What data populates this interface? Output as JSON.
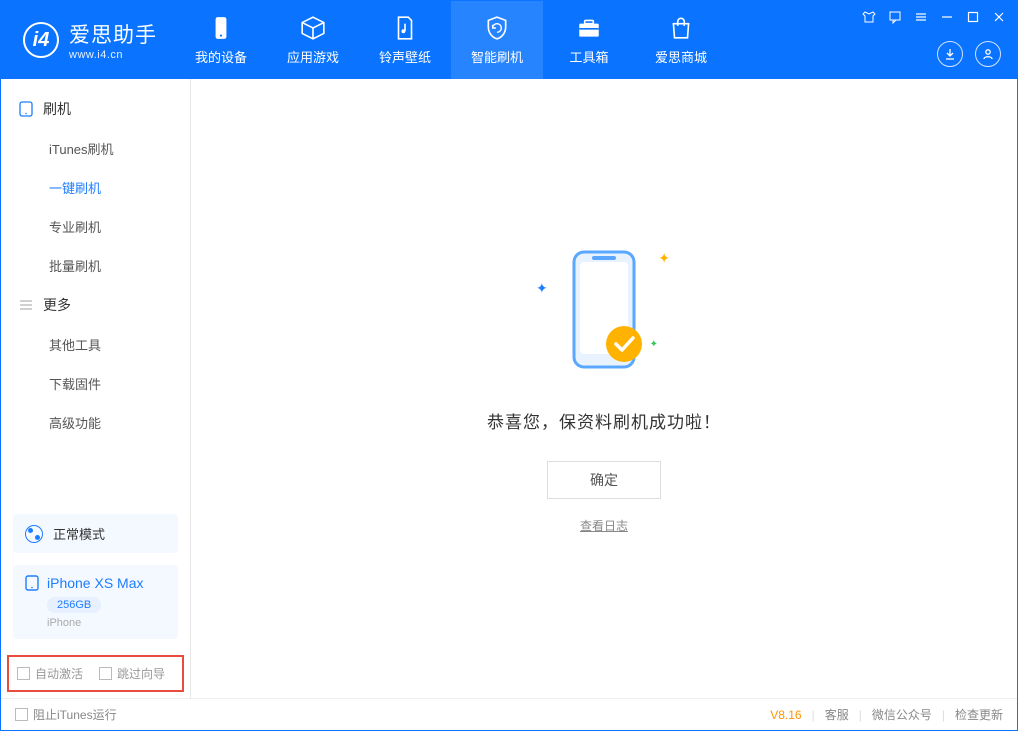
{
  "app": {
    "title": "爱思助手",
    "subtitle": "www.i4.cn"
  },
  "nav": [
    {
      "label": "我的设备"
    },
    {
      "label": "应用游戏"
    },
    {
      "label": "铃声壁纸"
    },
    {
      "label": "智能刷机"
    },
    {
      "label": "工具箱"
    },
    {
      "label": "爱思商城"
    }
  ],
  "sidebar": {
    "section1": {
      "title": "刷机",
      "items": [
        "iTunes刷机",
        "一键刷机",
        "专业刷机",
        "批量刷机"
      ]
    },
    "section2": {
      "title": "更多",
      "items": [
        "其他工具",
        "下载固件",
        "高级功能"
      ]
    }
  },
  "mode": {
    "label": "正常模式"
  },
  "device": {
    "name": "iPhone XS Max",
    "storage": "256GB",
    "type": "iPhone"
  },
  "bottom": {
    "opt1": "自动激活",
    "opt2": "跳过向导"
  },
  "main": {
    "success": "恭喜您，保资料刷机成功啦！",
    "ok": "确定",
    "log": "查看日志"
  },
  "status": {
    "left": "阻止iTunes运行",
    "version": "V8.16",
    "links": [
      "客服",
      "微信公众号",
      "检查更新"
    ]
  }
}
